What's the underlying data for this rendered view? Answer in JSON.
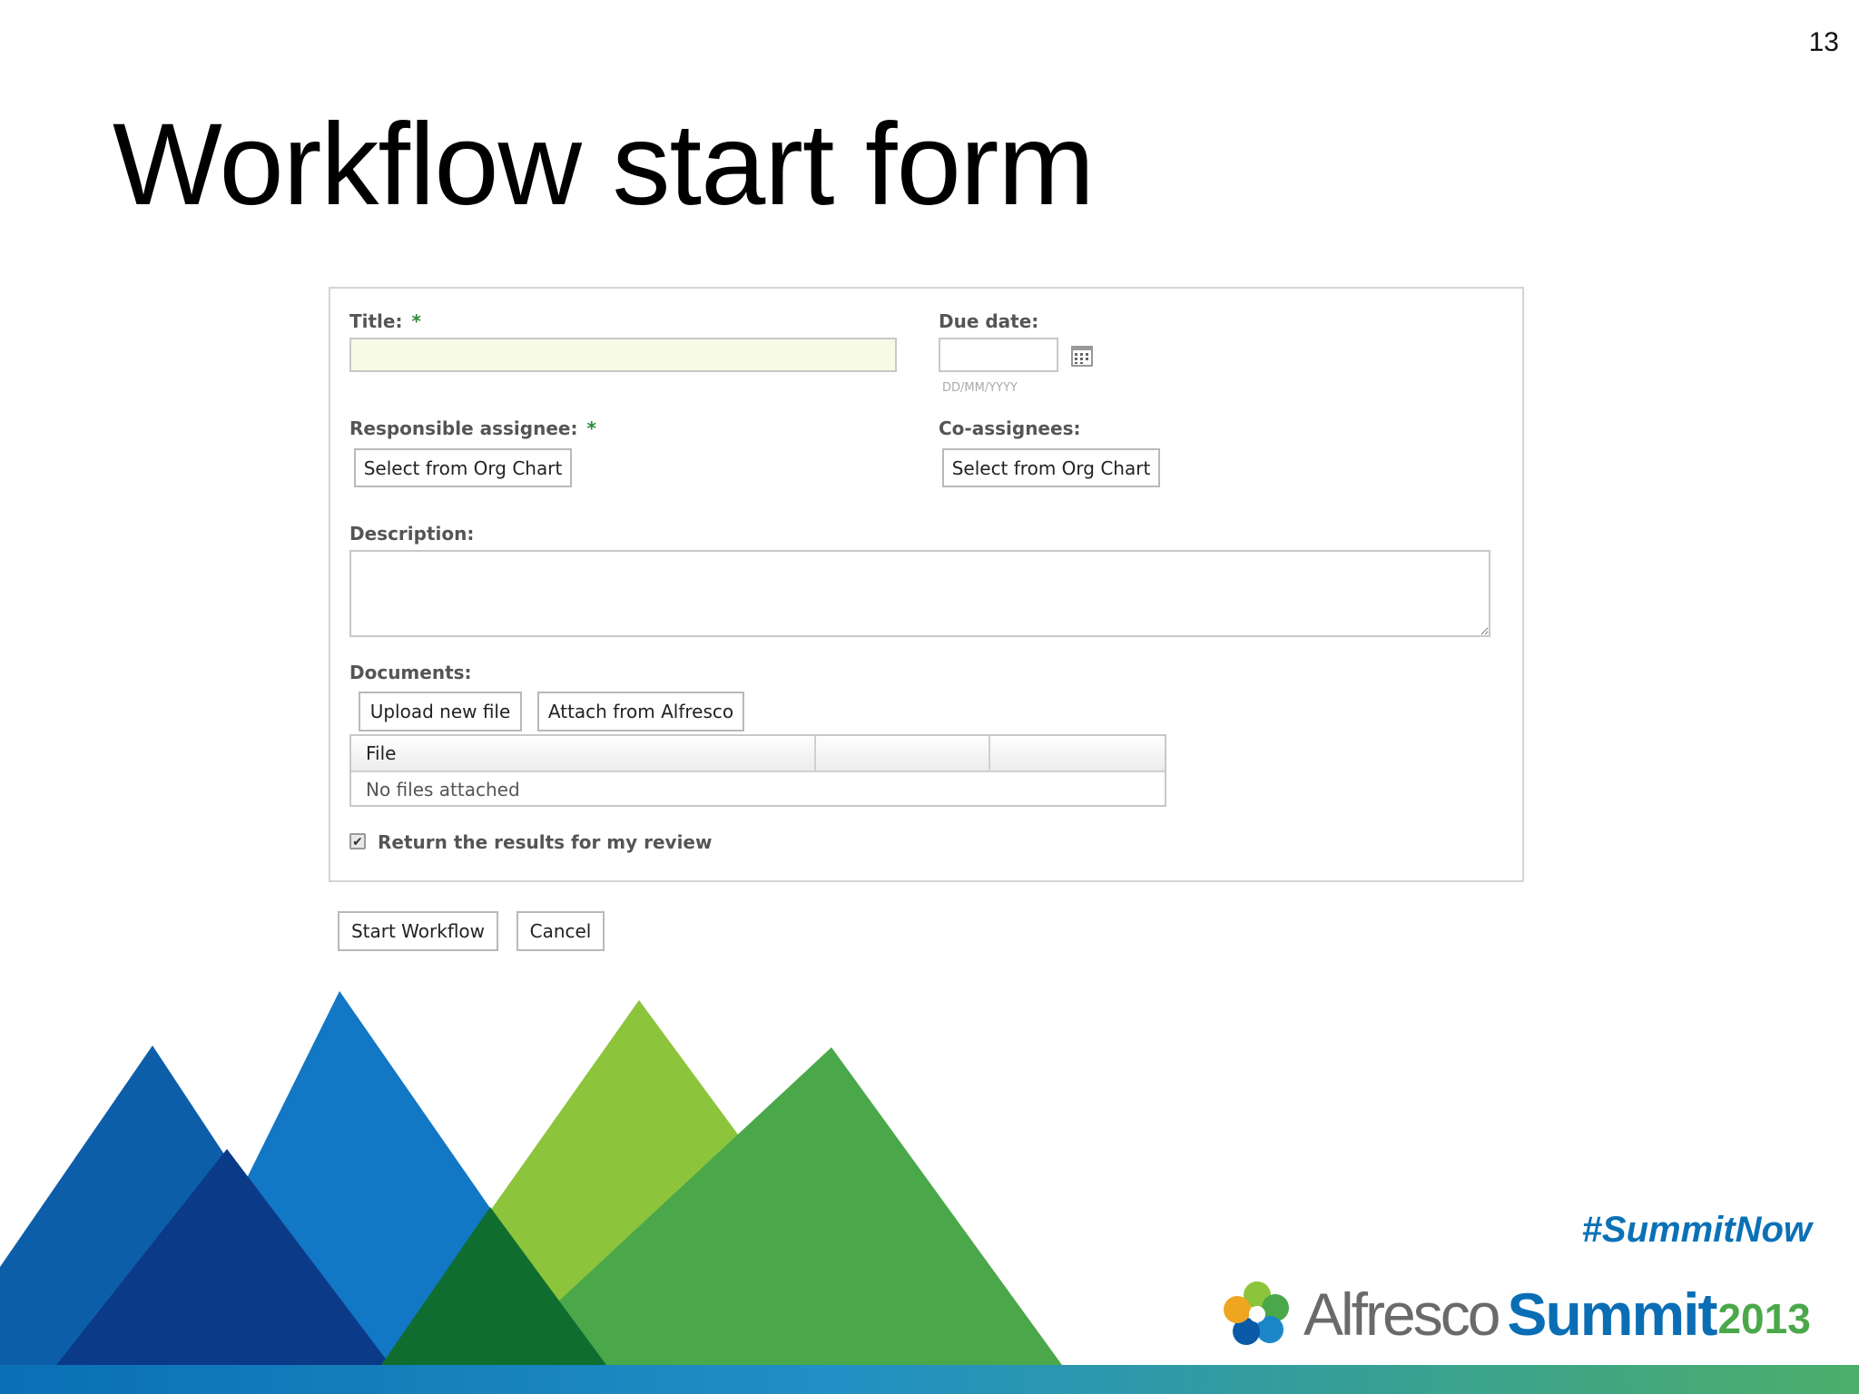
{
  "slide": {
    "number": "13",
    "title": "Workflow start form",
    "hashtag": "#SummitNow",
    "logo": {
      "alfresco": "Alfresco",
      "summit": "Summit",
      "year": "2013"
    }
  },
  "form": {
    "title_label": "Title:",
    "required_mark": "*",
    "due_date_label": "Due date:",
    "due_date_hint": "DD/MM/YYYY",
    "responsible_label": "Responsible assignee:",
    "co_assignees_label": "Co-assignees:",
    "select_org_chart": "Select from Org Chart",
    "description_label": "Description:",
    "documents_label": "Documents:",
    "upload_label": "Upload new file",
    "attach_label": "Attach from Alfresco",
    "files_table": {
      "columns": [
        "File",
        "",
        ""
      ],
      "empty_text": "No files attached"
    },
    "return_results_label": "Return the results for my review",
    "return_results_checked": true
  },
  "actions": {
    "start_label": "Start Workflow",
    "cancel_label": "Cancel"
  },
  "colors": {
    "title_input_bg": "#f7fbe6",
    "required": "#2e8b3a",
    "hashtag": "#0b71b6"
  }
}
